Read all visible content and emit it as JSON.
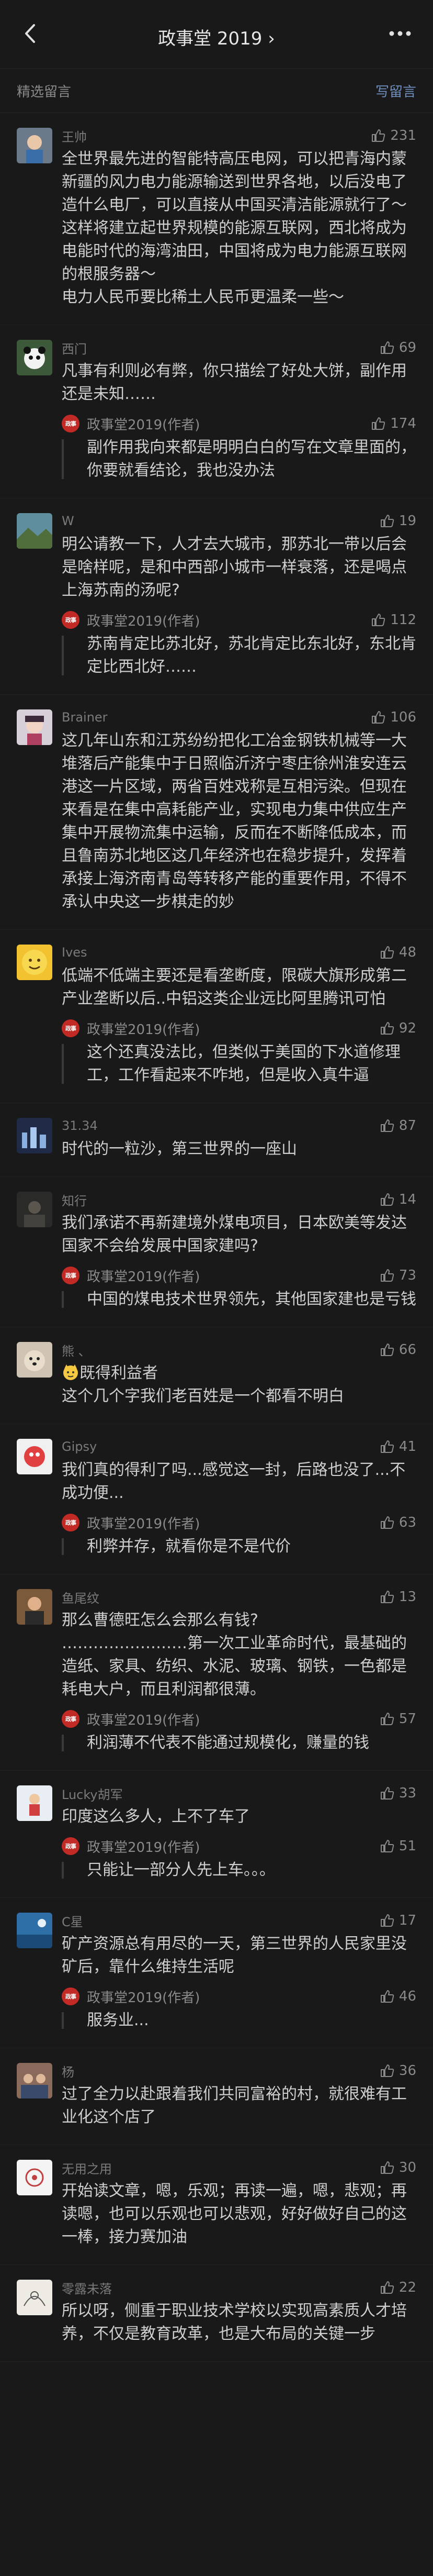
{
  "header": {
    "title": "政事堂 2019",
    "title_suffix": "›"
  },
  "section": {
    "title": "精选留言",
    "write": "写留言"
  },
  "reply_author": "政事堂2019(作者)",
  "comments": [
    {
      "nick": "王帅",
      "likes": "231",
      "text": "全世界最先进的智能特高压电网，可以把青海内蒙新疆的风力电力能源输送到世界各地，以后没电了造什么电厂，可以直接从中国买清洁能源就行了～\n这样将建立起世界规模的能源互联网，西北将成为电能时代的海湾油田，中国将成为电力能源互联网的根服务器～\n电力人民币要比稀土人民币更温柔一些～",
      "avatar": "photo-child"
    },
    {
      "nick": "西门",
      "likes": "69",
      "text": "凡事有利则必有弊，你只描绘了好处大饼，副作用还是未知……",
      "avatar": "panda",
      "reply": {
        "likes": "174",
        "text": "副作用我向来都是明明白白的写在文章里面的，你要就看结论，我也没办法"
      }
    },
    {
      "nick": "W",
      "likes": "19",
      "text": "明公请教一下，人才去大城市，那苏北一带以后会是啥样呢，是和中西部小城市一样衰落，还是喝点上海苏南的汤呢?",
      "avatar": "landscape",
      "reply": {
        "likes": "112",
        "text": "苏南肯定比苏北好，苏北肯定比东北好，东北肯定比西北好……"
      }
    },
    {
      "nick": "Brainer",
      "likes": "106",
      "text": "这几年山东和江苏纷纷把化工冶金钢铁机械等一大堆落后产能集中于日照临沂济宁枣庄徐州淮安连云港这一片区域，两省百姓戏称是互相污染。但现在来看是在集中高耗能产业，实现电力集中供应生产集中开展物流集中运输，反而在不断降低成本，而且鲁南苏北地区这几年经济也在稳步提升，发挥着承接上海济南青岛等转移产能的重要作用，不得不承认中央这一步棋走的妙",
      "avatar": "anime"
    },
    {
      "nick": "Ives",
      "likes": "48",
      "text": "低端不低端主要还是看垄断度，限碳大旗形成第二产业垄断以后..中铝这类企业远比阿里腾讯可怕",
      "avatar": "emoji-face",
      "reply": {
        "likes": "92",
        "text": "这个还真没法比，但类似于美国的下水道修理工，工作看起来不咋地，但是收入真牛逼"
      }
    },
    {
      "nick": "31.34",
      "likes": "87",
      "text": "时代的一粒沙，第三世界的一座山",
      "avatar": "city"
    },
    {
      "nick": "知行",
      "likes": "14",
      "text": "我们承诺不再新建境外煤电项目，日本欧美等发达国家不会给发展中国家建吗?",
      "avatar": "dark-photo",
      "reply": {
        "likes": "73",
        "text": "中国的煤电技术世界领先，其他国家建也是亏钱"
      }
    },
    {
      "nick": "熊 、",
      "likes": "66",
      "text": "既得利益者\n这个几个字我们老百姓是一个都看不明白",
      "avatar": "dog",
      "lead_emoji": true
    },
    {
      "nick": "Gipsy",
      "likes": "41",
      "text": "我们真的得利了吗...感觉这一封，后路也没了...不成功便...",
      "avatar": "cartoon-red",
      "reply": {
        "likes": "63",
        "text": "利弊并存，就看你是不是代价"
      }
    },
    {
      "nick": "鱼尾纹",
      "likes": "13",
      "text": "那么曹德旺怎么会那么有钱?\n……………………第一次工业革命时代，最基础的造纸、家具、纺织、水泥、玻璃、钢铁，一色都是耗电大户，而且利润都很薄。",
      "avatar": "person-photo",
      "reply": {
        "likes": "57",
        "text": "利润薄不代表不能通过规模化，赚量的钱"
      }
    },
    {
      "nick": "Lucky胡军",
      "likes": "33",
      "text": "印度这么多人，上不了车了",
      "avatar": "small-figure",
      "reply": {
        "likes": "51",
        "text": "只能让一部分人先上车。。。"
      }
    },
    {
      "nick": "C星",
      "likes": "17",
      "text": "矿产资源总有用尽的一天，第三世界的人民家里没矿后，靠什么维持生活呢",
      "avatar": "blue-photo",
      "reply": {
        "likes": "46",
        "text": "服务业..."
      }
    },
    {
      "nick": "杨",
      "likes": "36",
      "text": "过了全力以赴跟着我们共同富裕的村，就很难有工业化这个店了",
      "avatar": "group-photo"
    },
    {
      "nick": "无用之用",
      "likes": "30",
      "text": "开始读文章，嗯，乐观；再读一遍，嗯，悲观；再读嗯，也可以乐观也可以悲观，好好做好自己的这一棒，接力赛加油",
      "avatar": "white-drawing"
    },
    {
      "nick": "零露未落",
      "likes": "22",
      "text": "所以呀，侧重于职业技术学校以实现高素质人才培养，不仅是教育改革，也是大布局的关键一步",
      "avatar": "sketch"
    }
  ]
}
